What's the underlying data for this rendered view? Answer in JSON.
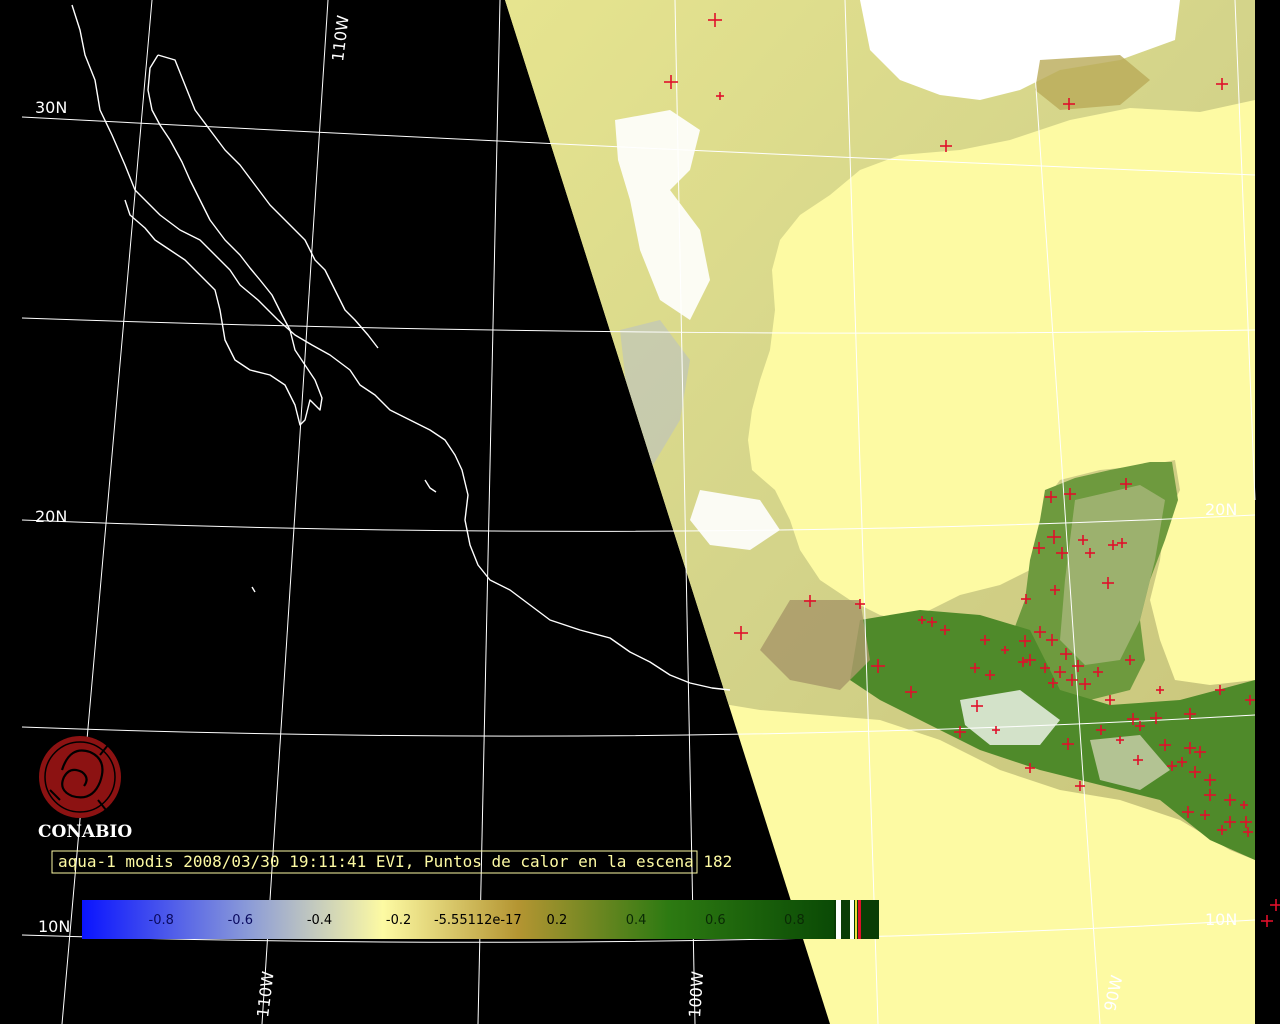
{
  "map": {
    "grid_labels": {
      "lat_30n": "30N",
      "lat_20n_left": "20N",
      "lat_20n_right": "20N",
      "lat_10n_left": "10N",
      "lat_10n_right": "10N",
      "lon_110w_top": "110W",
      "lon_110w_bottom": "110W",
      "lon_100w_bottom": "100W",
      "lon_90w_bottom": "90W"
    },
    "colors": {
      "background": "#000000",
      "grid": "#ffffff",
      "coastline": "#ffffff",
      "ocean_fill": "#fdfaa3",
      "fire_marker": "#e0102a",
      "logo": "#8c1212",
      "caption_border": "#fdfaa3",
      "caption_text": "#fdfaa3"
    },
    "fire_marker_icon": "red-plus-icon"
  },
  "logo": {
    "name": "CONABIO",
    "icon": "conabio-snail-seal-icon"
  },
  "caption": {
    "text": "aqua-1 modis 2008/03/30 19:11:41 EVI, Puntos de calor en la escena 182"
  },
  "colorbar": {
    "ticks": [
      {
        "value": -0.8,
        "label": "-0.8"
      },
      {
        "value": -0.6,
        "label": "-0.6"
      },
      {
        "value": -0.4,
        "label": "-0.4"
      },
      {
        "value": -0.2,
        "label": "-0.2"
      },
      {
        "value": -5.55112e-17,
        "label": "-5.55112e-17"
      },
      {
        "value": 0.2,
        "label": "0.2"
      },
      {
        "value": 0.4,
        "label": "0.4"
      },
      {
        "value": 0.6,
        "label": "0.6"
      },
      {
        "value": 0.8,
        "label": "0.8"
      }
    ],
    "stops": [
      "#0a14ff",
      "#8a9ad8",
      "#fdfaa3",
      "#b49532",
      "#2d7a12",
      "#0a4a05"
    ]
  }
}
